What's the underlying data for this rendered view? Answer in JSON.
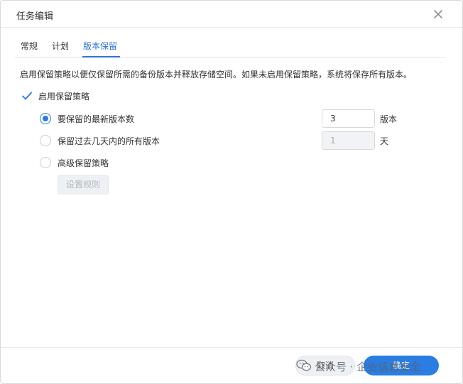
{
  "dialog": {
    "title": "任务编辑",
    "close_icon": "close-icon"
  },
  "tabs": [
    {
      "label": "常规",
      "active": false
    },
    {
      "label": "计划",
      "active": false
    },
    {
      "label": "版本保留",
      "active": true
    }
  ],
  "content": {
    "description": "启用保留策略以便仅保留所需的备份版本并释放存储空间。如果未启用保留策略，系统将保存所有版本。",
    "enable_policy": {
      "label": "启用保留策略",
      "checked": true
    },
    "options": [
      {
        "label": "要保留的最新版本数",
        "selected": true,
        "value": "3",
        "unit": "版本"
      },
      {
        "label": "保留过去几天内的所有版本",
        "selected": false,
        "value": "1",
        "unit": "天"
      },
      {
        "label": "高级保留策略",
        "selected": false
      }
    ],
    "rules_button": "设置规则"
  },
  "footer": {
    "cancel_label": "取消",
    "confirm_label": "确定"
  },
  "watermark": {
    "text": "公众号 · 企业信息安全",
    "icon": "wechat-icon"
  },
  "colors": {
    "accent": "#2a7de1",
    "tab_active": "#2f6fd1"
  }
}
